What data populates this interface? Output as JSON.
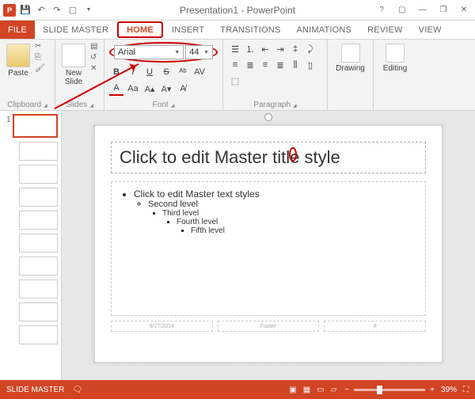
{
  "titlebar": {
    "title": "Presentation1 - PowerPoint"
  },
  "tabs": {
    "file": "FILE",
    "slide_master": "SLIDE MASTER",
    "home": "HOME",
    "insert": "INSERT",
    "transitions": "TRANSITIONS",
    "animations": "ANIMATIONS",
    "review": "REVIEW",
    "view": "VIEW"
  },
  "ribbon": {
    "clipboard": {
      "paste": "Paste",
      "label": "Clipboard"
    },
    "slides": {
      "new_slide": "New\nSlide",
      "label": "Slides"
    },
    "font": {
      "name": "Arial",
      "size": "44",
      "label": "Font"
    },
    "paragraph": {
      "label": "Paragraph"
    },
    "drawing": {
      "btn": "Drawing",
      "label": ""
    },
    "editing": {
      "btn": "Editing",
      "label": ""
    }
  },
  "slide": {
    "title_placeholder": "Click to edit Master title style",
    "body": {
      "l1": "Click to edit Master text styles",
      "l2": "Second level",
      "l3": "Third level",
      "l4": "Fourth level",
      "l5": "Fifth level"
    },
    "footer_date": "8/27/2014",
    "footer_center": "Footer",
    "footer_num": "#"
  },
  "status": {
    "mode": "SLIDE MASTER",
    "zoom": "39%"
  },
  "thumb_count": "1"
}
